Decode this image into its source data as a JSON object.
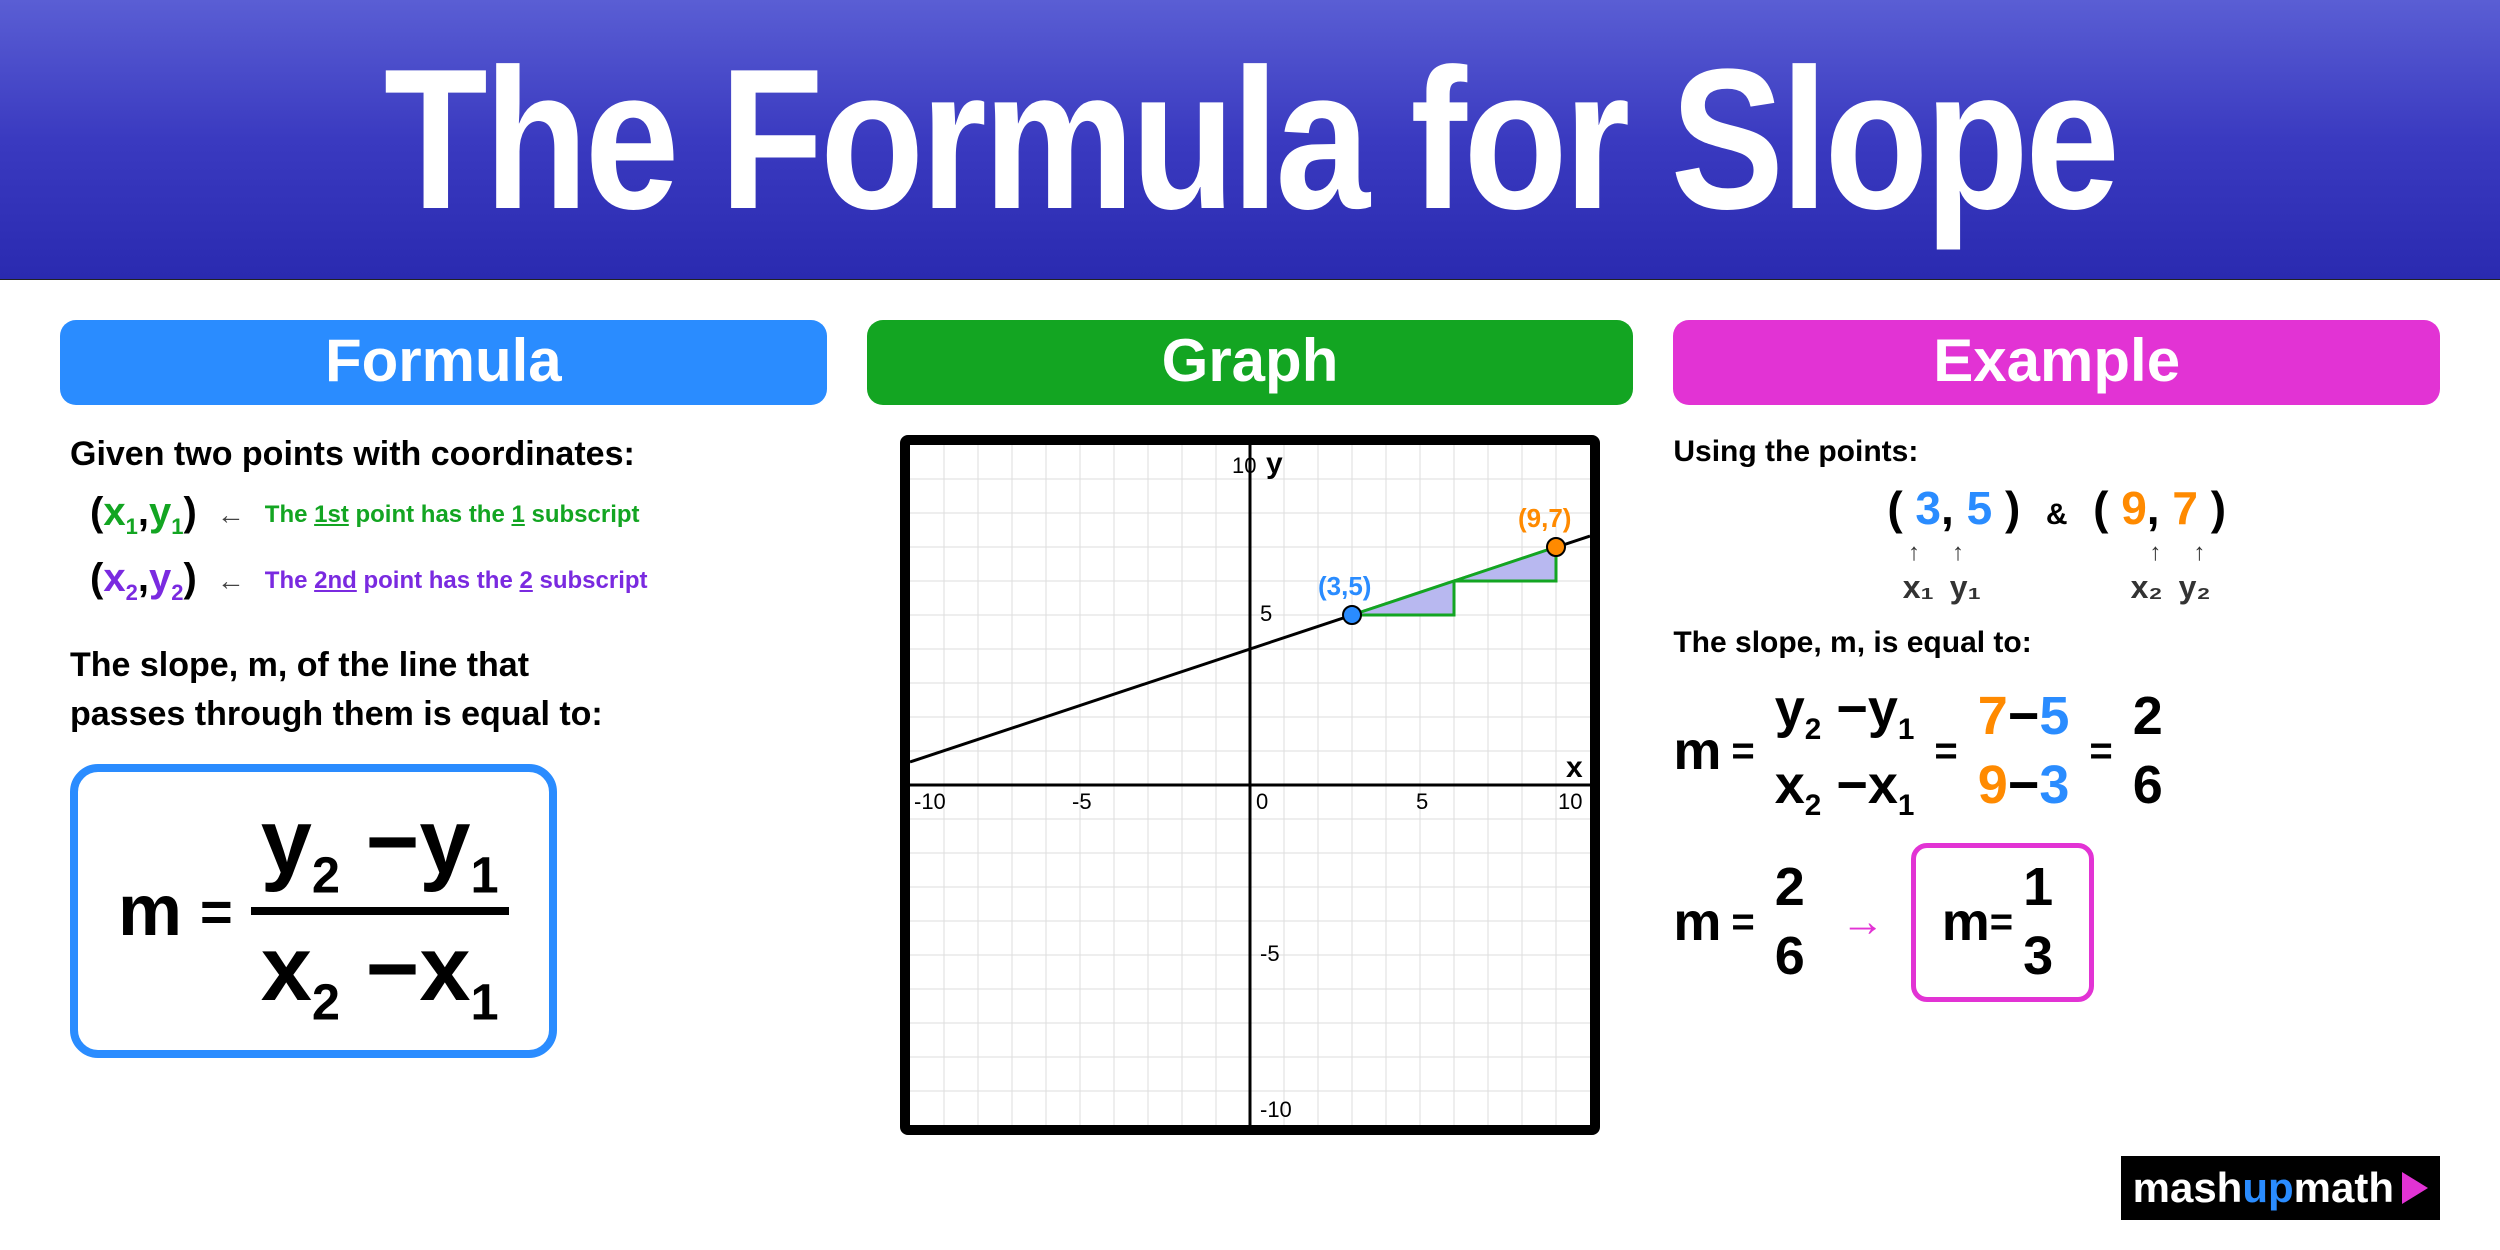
{
  "header": {
    "title": "The Formula for Slope"
  },
  "formula": {
    "header": "Formula",
    "intro": "Given two points with coordinates:",
    "p1_annot": "The 1st point has the 1 subscript",
    "p2_annot": "The 2nd point has the 2 subscript",
    "desc_line1": "The slope, m, of the line that",
    "desc_line2": "passes through them is equal to:",
    "m": "m",
    "eq": "="
  },
  "graph": {
    "header": "Graph",
    "ylabel": "y",
    "xlabel": "x",
    "ticks": {
      "neg10": "-10",
      "neg5": "-5",
      "zero": "0",
      "p5": "5",
      "p10": "10",
      "top10": "10"
    },
    "p1_label": "(3,5)",
    "p2_label": "(9,7)"
  },
  "example": {
    "header": "Example",
    "intro": "Using the points:",
    "p1": {
      "open": "(",
      "x": "3",
      "c": ",",
      "y": "5",
      "close": ")"
    },
    "amp": "&",
    "p2": {
      "open": "(",
      "x": "9",
      "c": ",",
      "y": "7",
      "close": ")"
    },
    "sub": {
      "x1": "x₁",
      "y1": "y₁",
      "x2": "x₂",
      "y2": "y₂"
    },
    "arrow": "↑",
    "lead2": "The slope, m, is equal to:",
    "m": "m",
    "eq": "=",
    "num1": {
      "a": "7",
      "dash": "−",
      "b": "5"
    },
    "den1": {
      "a": "9",
      "dash": "−",
      "b": "3"
    },
    "r1": {
      "n": "2",
      "d": "6"
    },
    "r2": {
      "n": "1",
      "d": "3"
    },
    "rarrow": "→"
  },
  "logo": {
    "a": "mash",
    "b": "up",
    "c": "math"
  },
  "chart_data": {
    "type": "line",
    "title": "",
    "xlabel": "x",
    "ylabel": "y",
    "xlim": [
      -10,
      10
    ],
    "ylim": [
      -10,
      10
    ],
    "grid": true,
    "points": [
      {
        "name": "P1",
        "x": 3,
        "y": 5,
        "label": "(3,5)",
        "color": "#2a8cff"
      },
      {
        "name": "P2",
        "x": 9,
        "y": 7,
        "label": "(9,7)",
        "color": "#ff8a00"
      }
    ],
    "line": {
      "slope": 0.3333,
      "intercept": 4
    },
    "rise_run": {
      "rise": 2,
      "run": 6
    }
  }
}
